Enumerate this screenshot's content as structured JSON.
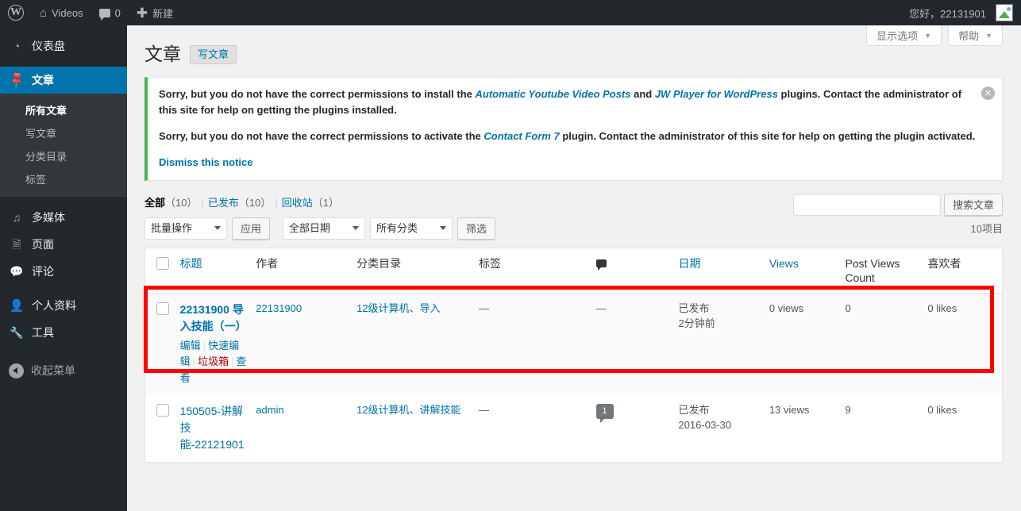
{
  "adminbar": {
    "wp_logo": "W",
    "site_name": "Videos",
    "comments_count": "0",
    "new_label": "新建",
    "greeting": "您好，22131901",
    "icons": {
      "home": "home-icon",
      "comment": "comment-bubble-icon",
      "plus": "plus-icon",
      "avatar": "broken-avatar-image"
    }
  },
  "sidebar": {
    "items": [
      {
        "label": "仪表盘",
        "icon": "dashboard-gauge-icon",
        "current": false
      },
      {
        "label": "文章",
        "icon": "pin-icon",
        "current": true
      },
      {
        "label": "多媒体",
        "icon": "media-icon",
        "current": false
      },
      {
        "label": "页面",
        "icon": "page-icon",
        "current": false
      },
      {
        "label": "评论",
        "icon": "comment-icon",
        "current": false
      },
      {
        "label": "个人资料",
        "icon": "user-icon",
        "current": false
      },
      {
        "label": "工具",
        "icon": "wrench-icon",
        "current": false
      }
    ],
    "submenu": [
      {
        "label": "所有文章",
        "current": true
      },
      {
        "label": "写文章",
        "current": false
      },
      {
        "label": "分类目录",
        "current": false
      },
      {
        "label": "标签",
        "current": false
      }
    ],
    "collapse_label": "收起菜单"
  },
  "screen_meta": {
    "screen_options": "显示选项",
    "help": "帮助"
  },
  "page": {
    "title": "文章",
    "add_new": "写文章"
  },
  "notice": {
    "line1_a": "Sorry, but you do not have the correct permissions to install the ",
    "link1": "Automatic Youtube Video Posts",
    "line1_b": " and ",
    "link2": "JW Player for WordPress",
    "line1_c": " plugins. Contact the administrator of this site for help on getting the plugins installed.",
    "line2_a": "Sorry, but you do not have the correct permissions to activate the ",
    "link3": "Contact Form 7",
    "line2_b": " plugin. Contact the administrator of this site for help on getting the plugin activated.",
    "dismiss": "Dismiss this notice",
    "dismiss_icon": "close-icon",
    "accent_color": "#46b450"
  },
  "filters": {
    "status_links": [
      {
        "label": "全部",
        "count": "（10）",
        "current": true
      },
      {
        "label": "已发布",
        "count": "（10）",
        "current": false
      },
      {
        "label": "回收站",
        "count": "（1）",
        "current": false
      }
    ],
    "bulk_action": "批量操作",
    "apply": "应用",
    "date_filter": "全部日期",
    "category_filter": "所有分类",
    "filter_button": "筛选",
    "search_value": "",
    "search_placeholder": "",
    "search_button": "搜索文章",
    "displaying_num": "10项目"
  },
  "table": {
    "columns": [
      {
        "key": "cb",
        "label": "",
        "sortable": false
      },
      {
        "key": "title",
        "label": "标题",
        "sortable": true
      },
      {
        "key": "author",
        "label": "作者",
        "sortable": false
      },
      {
        "key": "categories",
        "label": "分类目录",
        "sortable": false
      },
      {
        "key": "tags",
        "label": "标签",
        "sortable": false
      },
      {
        "key": "comments",
        "label": "comment-bubble-icon",
        "sortable": false
      },
      {
        "key": "date",
        "label": "日期",
        "sortable": true
      },
      {
        "key": "views",
        "label": "Views",
        "sortable": true
      },
      {
        "key": "pvc",
        "label": "Post Views Count",
        "sortable": false
      },
      {
        "key": "likes",
        "label": "喜欢者",
        "sortable": false
      }
    ],
    "rows": [
      {
        "title": "22131900 导入技能（一）",
        "title_bold": true,
        "actions": [
          {
            "label": "编辑",
            "kind": "edit"
          },
          {
            "label": "快速编辑",
            "kind": "quick-edit"
          },
          {
            "label": "垃圾箱",
            "kind": "trash"
          },
          {
            "label": "查看",
            "kind": "view"
          }
        ],
        "author": "22131900",
        "categories": "12级计算机、导入",
        "tags": "—",
        "comments": "—",
        "status": "已发布",
        "date": "2分钟前",
        "views": "0 views",
        "pvc": "0",
        "likes": "0 likes",
        "highlighted": true
      },
      {
        "title": "150505-讲解技\n能-22121901",
        "title_bold": false,
        "actions": [],
        "author": "admin",
        "categories": "12级计算机、讲解技能",
        "tags": "—",
        "comments": "1",
        "status": "已发布",
        "date": "2016-03-30",
        "views": "13 views",
        "pvc": "9",
        "likes": "0 likes",
        "highlighted": false
      }
    ]
  },
  "colors": {
    "admin_bar": "#23282d",
    "sidebar": "#23282d",
    "current_menu": "#0073aa",
    "link": "#0073aa",
    "highlight_box": "#fe0000",
    "trash_link": "#a00"
  }
}
